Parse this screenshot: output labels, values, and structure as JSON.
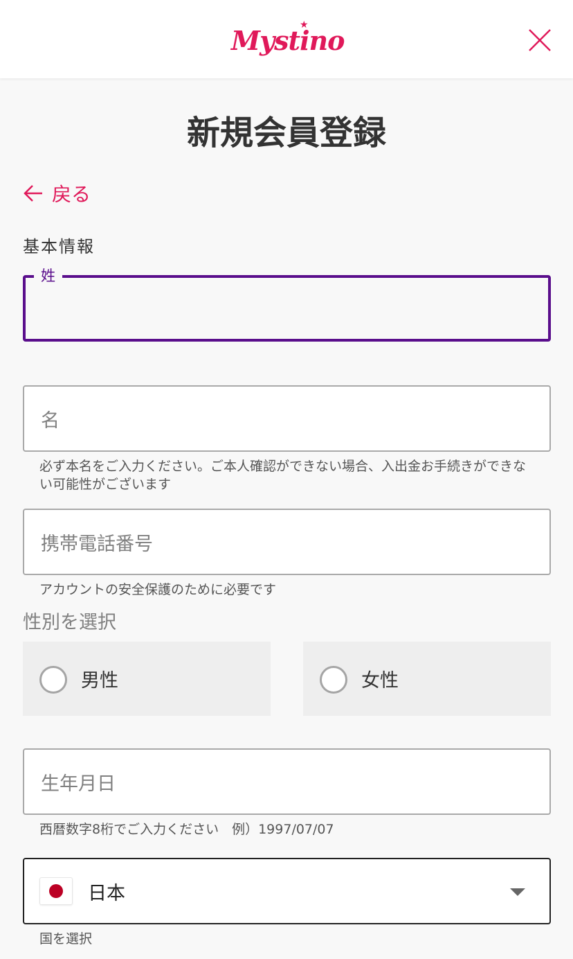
{
  "header": {
    "logo_text": "Mystino",
    "logo_star": "★",
    "close_icon": "close-icon"
  },
  "colors": {
    "brand": "#e0195a",
    "focus": "#5a0e8c"
  },
  "page": {
    "title": "新規会員登録",
    "back_label": "戻る",
    "back_icon": "arrow-left-icon"
  },
  "form": {
    "section_label": "基本情報",
    "last_name": {
      "label": "姓",
      "value": ""
    },
    "first_name": {
      "placeholder": "名",
      "helper": "必ず本名をご入力ください。ご本人確認ができない場合、入出金お手続きができない可能性がございます"
    },
    "phone": {
      "placeholder": "携帯電話番号",
      "helper": "アカウントの安全保護のために必要です"
    },
    "gender": {
      "label": "性別を選択",
      "options": [
        {
          "label": "男性",
          "selected": false
        },
        {
          "label": "女性",
          "selected": false
        }
      ]
    },
    "birthdate": {
      "placeholder": "生年月日",
      "helper": "西暦数字8桁でご入力ください　例）1997/07/07"
    },
    "country": {
      "value": "日本",
      "flag_icon": "japan-flag-icon",
      "helper": "国を選択"
    }
  }
}
